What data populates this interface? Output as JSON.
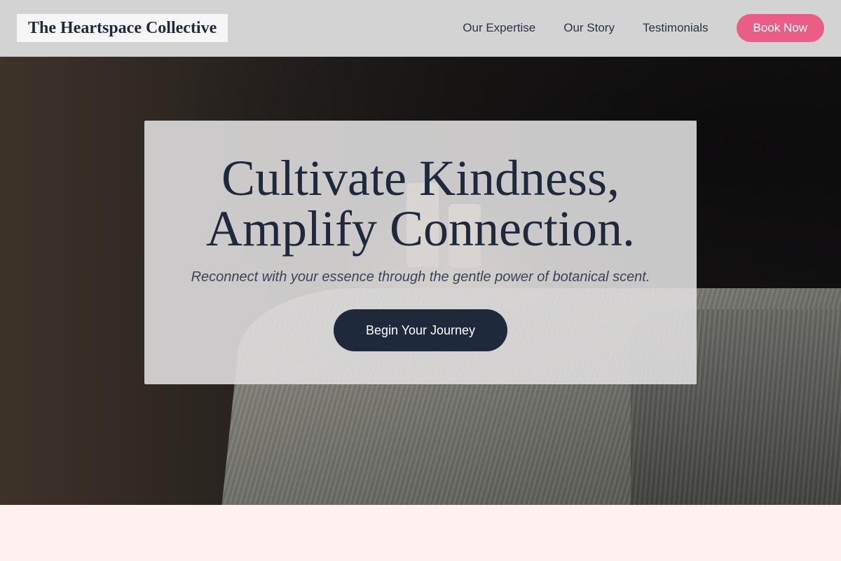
{
  "header": {
    "brand": "The Heartspace Collective",
    "nav": [
      {
        "label": "Our Expertise"
      },
      {
        "label": "Our Story"
      },
      {
        "label": "Testimonials"
      }
    ],
    "book_label": "Book Now"
  },
  "hero": {
    "title_line1": "Cultivate Kindness,",
    "title_line2": "Amplify Connection.",
    "subtitle": "Reconnect with your essence through the gentle power of botanical scent.",
    "cta_label": "Begin Your Journey"
  },
  "colors": {
    "accent_pink": "#e95d86",
    "navy": "#1e293b",
    "page_background": "#fff1f0",
    "header_background": "#d4d3d3"
  }
}
